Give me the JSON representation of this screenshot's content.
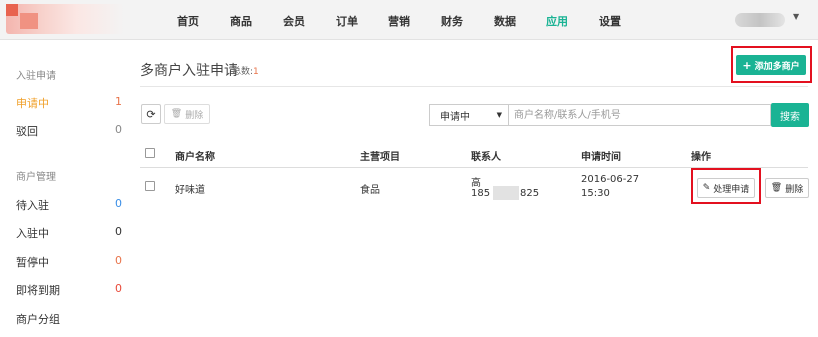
{
  "colors": {
    "accent": "#1ab394",
    "highlight": "#e3101f",
    "warning": "#f0a02a"
  },
  "nav": {
    "items": [
      {
        "label": "首页"
      },
      {
        "label": "商品"
      },
      {
        "label": "会员"
      },
      {
        "label": "订单"
      },
      {
        "label": "营销"
      },
      {
        "label": "财务"
      },
      {
        "label": "数据"
      },
      {
        "label": "应用",
        "active": true
      },
      {
        "label": "设置"
      }
    ]
  },
  "sidebar": {
    "group1_title": "入驻申请",
    "group1": [
      {
        "label": "申请中",
        "count": "1"
      },
      {
        "label": "驳回",
        "count": "0"
      }
    ],
    "group2_title": "商户管理",
    "group2": [
      {
        "label": "待入驻",
        "count": "0"
      },
      {
        "label": "入驻中",
        "count": "0"
      },
      {
        "label": "暂停中",
        "count": "0"
      },
      {
        "label": "即将到期",
        "count": "0"
      },
      {
        "label": "商户分组"
      }
    ]
  },
  "main": {
    "title": "多商户入驻申请",
    "total_label": "总数:",
    "total_value": "1",
    "add_button": "添加多商户",
    "delete_button": "删除",
    "status_select": "申请中",
    "search_placeholder": "商户名称/联系人/手机号",
    "search_button": "搜索"
  },
  "table": {
    "headers": [
      "商户名称",
      "主营项目",
      "联系人",
      "申请时间",
      "操作"
    ],
    "rows": [
      {
        "name": "好味道",
        "category": "食品",
        "contact_name": "高",
        "contact_phone_start": "185",
        "contact_phone_end": "825",
        "date": "2016-06-27",
        "time": "15:30",
        "process_label": "处理申请",
        "delete_label": "删除"
      }
    ]
  }
}
